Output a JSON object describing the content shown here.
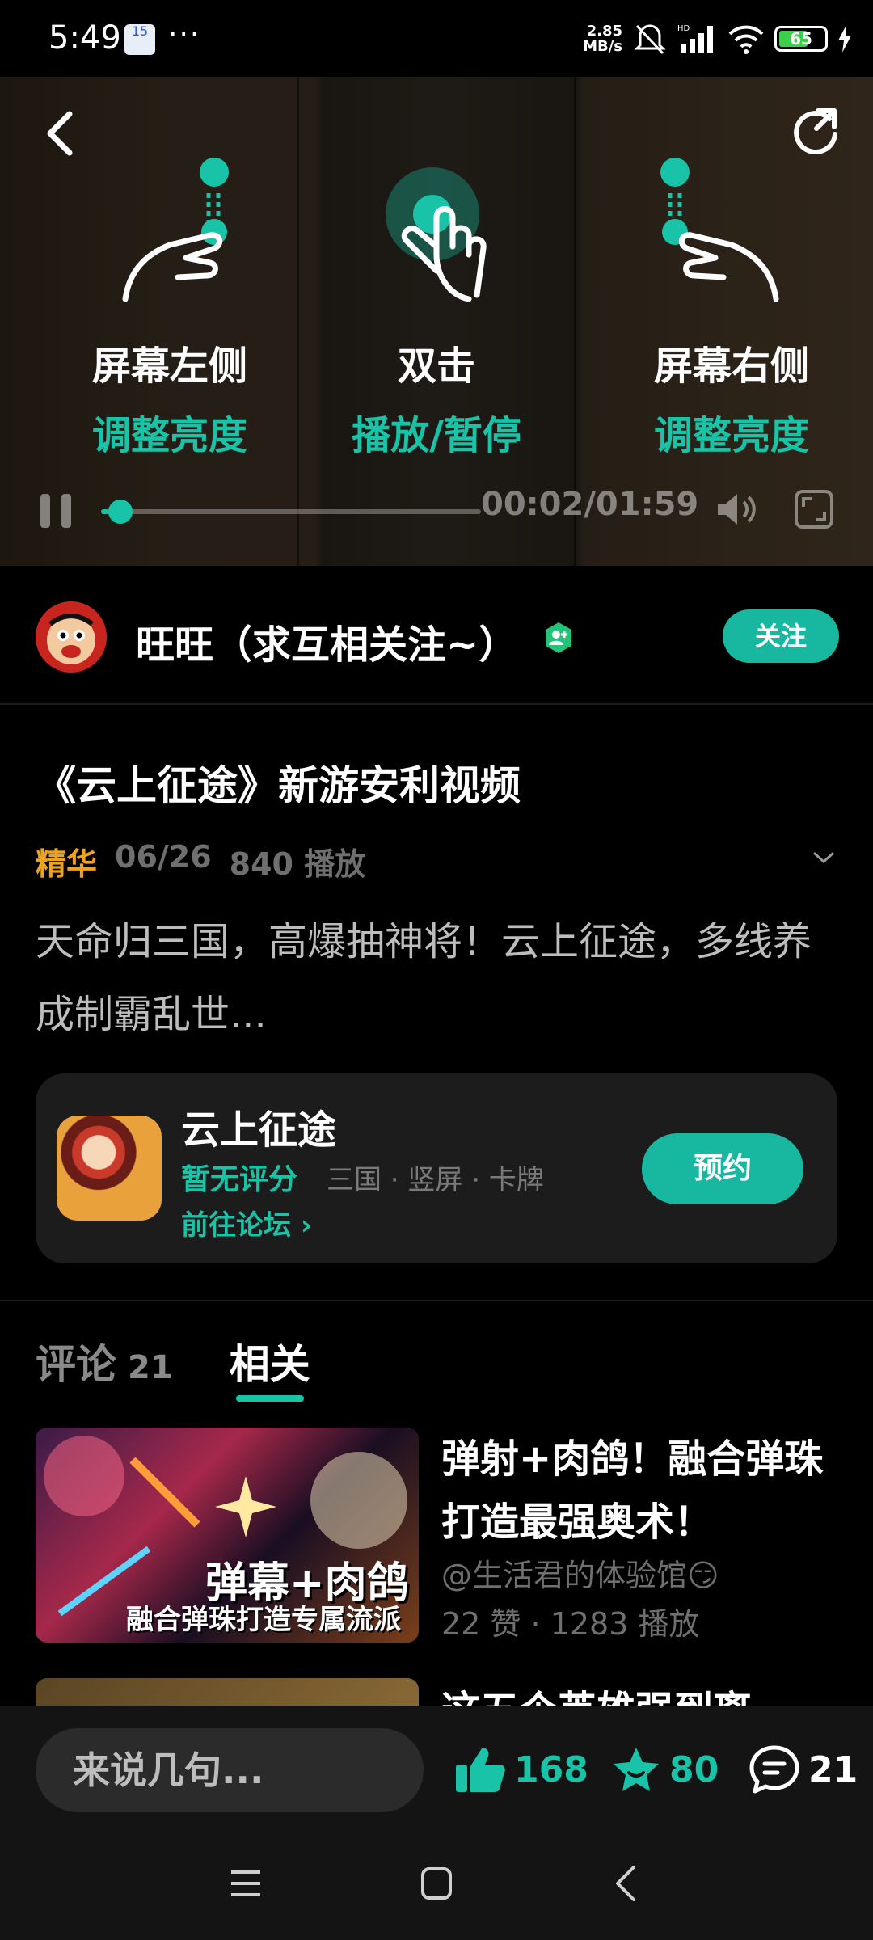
{
  "status_bar": {
    "time": "5:49",
    "calendar_day": "15",
    "overflow": "···",
    "net_speed_value": "2.85",
    "net_speed_unit": "MB/s",
    "hd_label": "HD",
    "battery_level": "65"
  },
  "video": {
    "gestures": [
      {
        "title": "屏幕左侧",
        "subtitle": "调整亮度"
      },
      {
        "title": "双击",
        "subtitle": "播放/暂停"
      },
      {
        "title": "屏幕右侧",
        "subtitle": "调整亮度"
      }
    ],
    "time_display": "00:02/01:59",
    "progress_fraction": 0.02
  },
  "author": {
    "name": "旺旺（求互相关注~）",
    "follow_label": "关注"
  },
  "post": {
    "title": "《云上征途》新游安利视频",
    "tag": "精华",
    "date": "06/26",
    "plays": "840 播放",
    "description": "天命归三国，高爆抽神将！云上征途，多线养成制霸乱世..."
  },
  "game": {
    "name": "云上征途",
    "rating": "暂无评分",
    "tags": "三国 · 竖屏 · 卡牌",
    "forum_link": "前往论坛 ›",
    "reserve_label": "预约"
  },
  "tabs": [
    {
      "label": "评论",
      "count": "21"
    },
    {
      "label": "相关"
    }
  ],
  "related": [
    {
      "title": "弹射+肉鸽！融合弹珠打造最强奥术！",
      "author": "@生活君的体验馆😏",
      "stats": "22 赞 · 1283 播放",
      "thumb_text_1": "弹幕+肉鸽",
      "thumb_text_2": "融合弹珠打造专属流派"
    },
    {
      "title": "这五个英雄强到离"
    }
  ],
  "action_bar": {
    "comment_placeholder": "来说几句...",
    "likes": "168",
    "favorites": "80",
    "comments": "21"
  },
  "colors": {
    "accent": "#18c3a7",
    "tag_orange": "#f0a21c",
    "background": "#000000"
  }
}
